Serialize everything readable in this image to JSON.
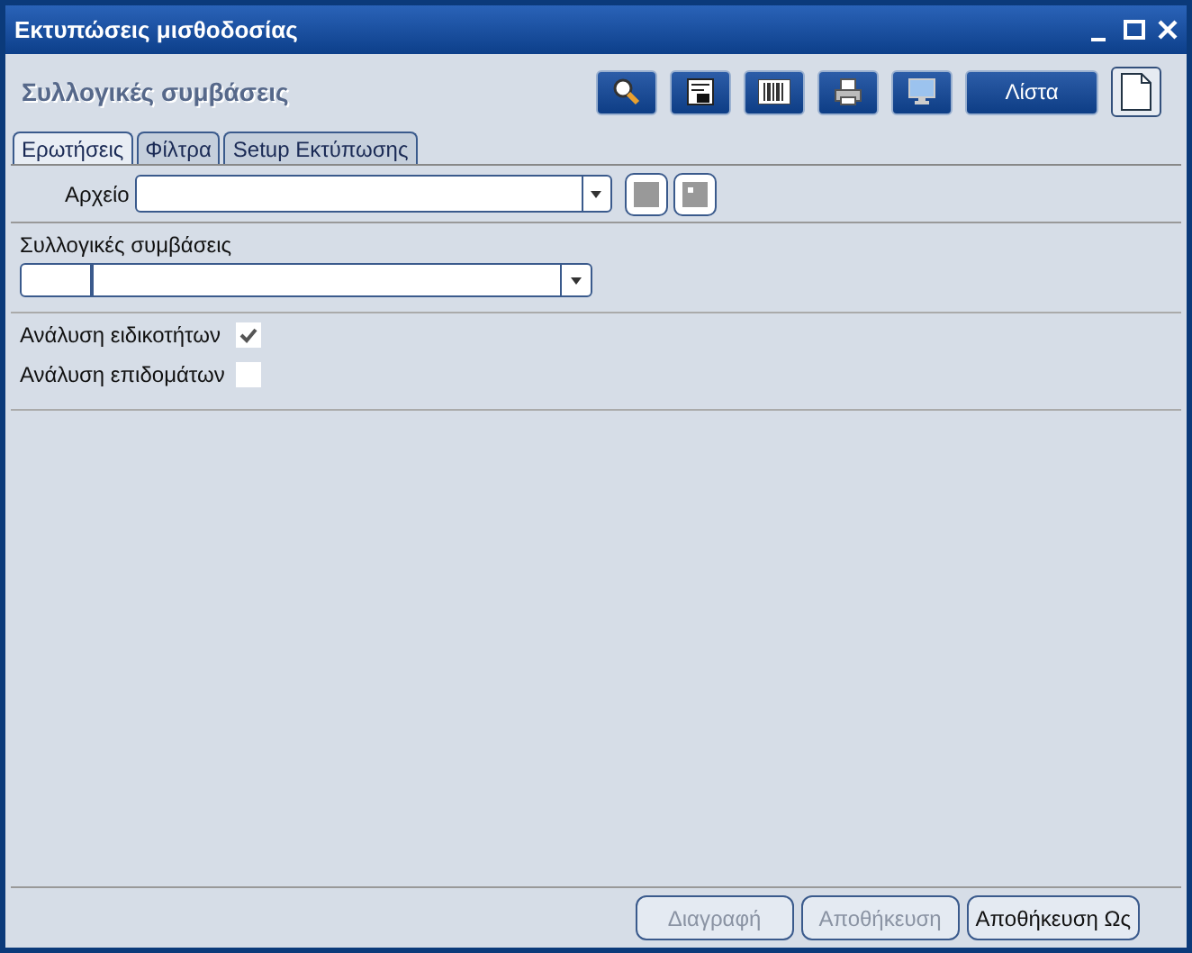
{
  "window": {
    "title": "Εκτυπώσεις μισθοδοσίας"
  },
  "header": {
    "title": "Συλλογικές συμβάσεις"
  },
  "toolbar": [
    {
      "kind": "search"
    },
    {
      "kind": "form"
    },
    {
      "kind": "barcode"
    },
    {
      "kind": "printer"
    },
    {
      "kind": "monitor"
    },
    {
      "kind": "text",
      "label": "Λίστα"
    },
    {
      "kind": "document"
    }
  ],
  "tabs": [
    {
      "label": "Ερωτήσεις",
      "selected": true
    },
    {
      "label": "Φίλτρα",
      "selected": false
    },
    {
      "label": "Setup Εκτύπωσης",
      "selected": false
    }
  ],
  "file_field": {
    "label": "Αρχείο"
  },
  "agreements": {
    "label": "Συλλογικές συμβάσεις"
  },
  "options": [
    {
      "label": "Ανάλυση ειδικοτήτων",
      "checked": true
    },
    {
      "label": "Ανάλυση επιδομάτων",
      "checked": false
    }
  ],
  "buttons": [
    {
      "label": "Διαγραφή",
      "disabled": true
    },
    {
      "label": "Αποθήκευση",
      "disabled": true
    },
    {
      "label": "Αποθήκευση Ως",
      "disabled": false
    }
  ]
}
